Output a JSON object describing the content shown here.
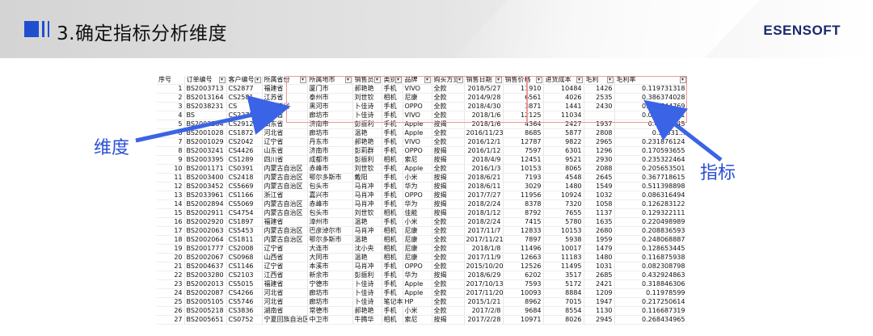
{
  "slide": {
    "title": "3.确定指标分析维度",
    "brand": "ESENSOFT",
    "accent_color": "#1f4fcf",
    "callouts": {
      "dimension": "维度",
      "indicator": "指标"
    },
    "callout_color": "#2a4fd8",
    "highlight_color": "#ec9a9a"
  },
  "sheet": {
    "headers": [
      "序号",
      "订单编号",
      "客户编号",
      "所属省份",
      "所属地市",
      "销售员",
      "类别",
      "品牌",
      "购买方式",
      "销售日期",
      "销售价格",
      "进货成本",
      "毛利",
      "毛利率"
    ],
    "rows": [
      [
        "1",
        "BS2003713",
        "CS2877",
        "福建省",
        "厦门市",
        "郝艳艳",
        "手机",
        "VIVO",
        "全款",
        "2018/5/27",
        "11910",
        "10484",
        "1426",
        "0.119731318"
      ],
      [
        "2",
        "BS2013164",
        "CS2581",
        "江苏省",
        "泰州市",
        "刘世钦",
        "相机",
        "尼康",
        "全款",
        "2014/9/28",
        "6561",
        "4026",
        "2535",
        "0.386374028"
      ],
      [
        "3",
        "BS2038231",
        "CS",
        "黑龙江省",
        "黑河市",
        "卜佳诗",
        "手机",
        "OPPO",
        "全款",
        "2018/4/30",
        "3871",
        "1441",
        "2430",
        "0.627744769"
      ],
      [
        "4",
        "BS",
        "CS2271",
        "河北省",
        "廊坊市",
        "卜佳诗",
        "手机",
        "VIVO",
        "全款",
        "2018/1/6",
        "12125",
        "11034",
        "",
        "0.089979381"
      ],
      [
        "5",
        "BS2002284",
        "CS2912",
        "山东省",
        "济南市",
        "彭振利",
        "手机",
        "Apple",
        "按揭",
        "2018/1/6",
        "4364",
        "2427",
        "1937",
        "0.443...845"
      ],
      [
        "6",
        "BS2001028",
        "CS1872",
        "河北省",
        "廊坊市",
        "温艳",
        "手机",
        "Apple",
        "全款",
        "2016/11/23",
        "8685",
        "5877",
        "2808",
        "0.32331..."
      ],
      [
        "7",
        "BS2001029",
        "CS2042",
        "辽宁省",
        "丹东市",
        "郝艳艳",
        "手机",
        "VIVO",
        "全款",
        "2016/12/1",
        "12787",
        "9822",
        "2965",
        "0.231876124"
      ],
      [
        "8",
        "BS2003241",
        "CS4426",
        "山东省",
        "济南市",
        "彭莉群",
        "手机",
        "OPPO",
        "按揭",
        "2016/1/12",
        "7597",
        "6301",
        "1296",
        "0.170593655"
      ],
      [
        "9",
        "BS2003395",
        "CS1289",
        "四川省",
        "成都市",
        "彭振利",
        "相机",
        "索尼",
        "按揭",
        "2018/4/9",
        "12451",
        "9521",
        "2930",
        "0.235322464"
      ],
      [
        "10",
        "BS2001171",
        "CS0391",
        "内蒙古自治区",
        "赤峰市",
        "刘世钦",
        "手机",
        "Apple",
        "全款",
        "2016/1/3",
        "10153",
        "8065",
        "2088",
        "0.205653501"
      ],
      [
        "11",
        "BS2003400",
        "CS2418",
        "内蒙古自治区",
        "鄂尔多斯市",
        "戴阳",
        "手机",
        "小米",
        "按揭",
        "2018/6/21",
        "7193",
        "4548",
        "2645",
        "0.367718615"
      ],
      [
        "12",
        "BS2003452",
        "CS5669",
        "内蒙古自治区",
        "包头市",
        "马肖冲",
        "手机",
        "华为",
        "按揭",
        "2018/6/11",
        "3029",
        "1480",
        "1549",
        "0.511398898"
      ],
      [
        "13",
        "BS2033961",
        "CS1166",
        "浙江省",
        "嘉兴市",
        "马肖冲",
        "手机",
        "OPPO",
        "按揭",
        "2017/7/27",
        "11956",
        "10924",
        "1032",
        "0.086316494"
      ],
      [
        "14",
        "BS2002894",
        "CS5069",
        "内蒙古自治区",
        "赤峰市",
        "马肖冲",
        "手机",
        "华为",
        "按揭",
        "2018/2/24",
        "8378",
        "7320",
        "1058",
        "0.126283122"
      ],
      [
        "15",
        "BS2002911",
        "CS4754",
        "内蒙古自治区",
        "包头市",
        "刘世钦",
        "相机",
        "佳能",
        "按揭",
        "2018/1/12",
        "8792",
        "7655",
        "1137",
        "0.129322111"
      ],
      [
        "16",
        "BS2002920",
        "CS1897",
        "福建省",
        "漳州市",
        "温艳",
        "手机",
        "小米",
        "全款",
        "2018/2/24",
        "7415",
        "5780",
        "1635",
        "0.220498989"
      ],
      [
        "17",
        "BS2002063",
        "CS5453",
        "内蒙古自治区",
        "巴彦淖尔市",
        "马肖冲",
        "相机",
        "尼康",
        "全款",
        "2017/11/7",
        "12833",
        "10153",
        "2680",
        "0.208836593"
      ],
      [
        "18",
        "BS2002064",
        "CS1811",
        "内蒙古自治区",
        "鄂尔多斯市",
        "温艳",
        "相机",
        "尼康",
        "全款",
        "2017/11/21",
        "7897",
        "5938",
        "1959",
        "0.248068887"
      ],
      [
        "19",
        "BS2001777",
        "CS2008",
        "辽宁省",
        "大连市",
        "沈小央",
        "相机",
        "尼康",
        "全款",
        "2018/1/8",
        "11496",
        "10017",
        "1479",
        "0.128653445"
      ],
      [
        "20",
        "BS2002067",
        "CS0968",
        "山西省",
        "大同市",
        "温艳",
        "相机",
        "尼康",
        "全款",
        "2017/11/9",
        "12663",
        "11183",
        "1480",
        "0.116875938"
      ],
      [
        "21",
        "BS2004637",
        "CS1146",
        "辽宁省",
        "本溪市",
        "马肖冲",
        "手机",
        "OPPO",
        "全款",
        "2015/10/20",
        "12526",
        "11495",
        "1031",
        "0.082308798"
      ],
      [
        "22",
        "BS2003280",
        "CS2103",
        "江西省",
        "新余市",
        "彭振利",
        "手机",
        "华为",
        "按揭",
        "2018/6/29",
        "6202",
        "3517",
        "2685",
        "0.432924863"
      ],
      [
        "23",
        "BS2002013",
        "CS5015",
        "福建省",
        "宁德市",
        "卜佳诗",
        "手机",
        "Apple",
        "全款",
        "2017/10/13",
        "7593",
        "5172",
        "2421",
        "0.318846306"
      ],
      [
        "24",
        "BS2002087",
        "CS4266",
        "河北省",
        "廊坊市",
        "卜佳诗",
        "手机",
        "Apple",
        "全款",
        "2017/11/20",
        "10093",
        "8884",
        "1209",
        "0.11978599"
      ],
      [
        "25",
        "BS2005105",
        "CS5746",
        "河北省",
        "廊坊市",
        "卜佳诗",
        "笔记本",
        "HP",
        "全款",
        "2015/1/21",
        "8962",
        "7015",
        "1947",
        "0.217250614"
      ],
      [
        "26",
        "BS2005218",
        "CS3836",
        "湖南省",
        "常德市",
        "郝艳艳",
        "手机",
        "小米",
        "全款",
        "2017/2/8",
        "9684",
        "8554",
        "1130",
        "0.116687319"
      ],
      [
        "27",
        "BS2005651",
        "CS0752",
        "宁夏回族自治区",
        "中卫市",
        "牛腾华",
        "相机",
        "索尼",
        "按揭",
        "2017/2/28",
        "10971",
        "8026",
        "2945",
        "0.268434965"
      ]
    ]
  }
}
